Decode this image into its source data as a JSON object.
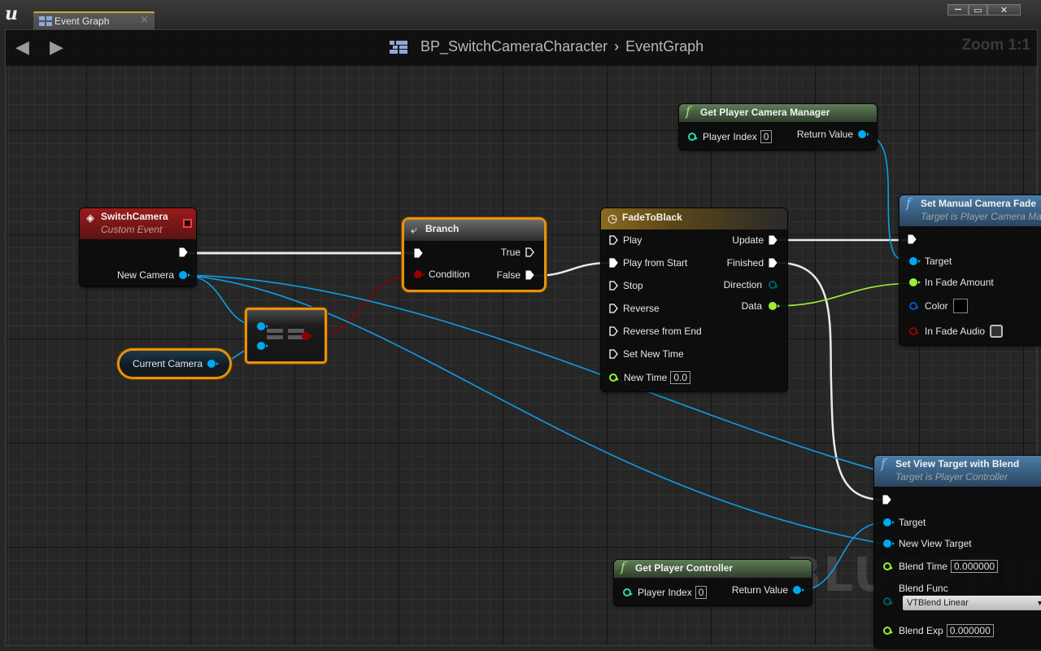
{
  "window": {
    "tab_label": "Event Graph",
    "tab_close": "×",
    "minimize": "—",
    "maximize": "▭",
    "close": "✕"
  },
  "toolbar": {
    "back_icon": "◀",
    "forward_icon": "▶",
    "breadcrumb_blueprint": "BP_SwitchCameraCharacter",
    "breadcrumb_separator": "›",
    "breadcrumb_graph": "EventGraph",
    "zoom_level": "Zoom 1:1"
  },
  "watermark": "BLUEPRINT",
  "colors": {
    "exec": "#ffffff",
    "object": "#00a8f0",
    "boolean": "#950000",
    "float": "#9cf03a",
    "struct_color": "#0055cc",
    "byte_enum": "#006060",
    "int": "#1fe0b0",
    "selection": "#e5920d",
    "event_header": "#8a1a1a",
    "function_header_pure": "#4e6b49",
    "function_header_callable": "#3b6a90",
    "timeline_header": "#7a5c1c"
  },
  "nodes": {
    "switch_camera": {
      "title": "SwitchCamera",
      "subtitle": "Custom Event",
      "pins": {
        "new_camera": "New Camera"
      }
    },
    "current_camera": {
      "label": "Current Camera"
    },
    "equals": {
      "symbol": "=="
    },
    "branch": {
      "title": "Branch",
      "pins": {
        "condition": "Condition",
        "true": "True",
        "false": "False"
      }
    },
    "fade_to_black": {
      "title": "FadeToBlack",
      "inputs": [
        "Play",
        "Play from Start",
        "Stop",
        "Reverse",
        "Reverse from End",
        "Set New Time"
      ],
      "new_time_label": "New Time",
      "new_time_value": "0.0",
      "outputs": {
        "update": "Update",
        "finished": "Finished",
        "direction": "Direction",
        "data": "Data"
      }
    },
    "get_player_camera_manager": {
      "title": "Get Player Camera Manager",
      "player_index_label": "Player Index",
      "player_index_value": "0",
      "return_value": "Return Value"
    },
    "set_manual_camera_fade": {
      "title": "Set Manual Camera Fade",
      "subtitle": "Target is Player Camera Manager",
      "pins": {
        "target": "Target",
        "in_fade_amount": "In Fade Amount",
        "color": "Color",
        "in_fade_audio": "In Fade Audio"
      },
      "in_fade_audio_checked": false
    },
    "set_view_target_with_blend": {
      "title": "Set View Target with Blend",
      "subtitle": "Target is Player Controller",
      "pins": {
        "target": "Target",
        "new_view_target": "New View Target",
        "blend_time": "Blend Time",
        "blend_time_value": "0.000000",
        "blend_func": "Blend Func",
        "blend_func_value": "VTBlend Linear",
        "blend_exp": "Blend Exp",
        "blend_exp_value": "0.000000"
      }
    },
    "get_player_controller": {
      "title": "Get Player Controller",
      "player_index_label": "Player Index",
      "player_index_value": "0",
      "return_value": "Return Value"
    }
  }
}
